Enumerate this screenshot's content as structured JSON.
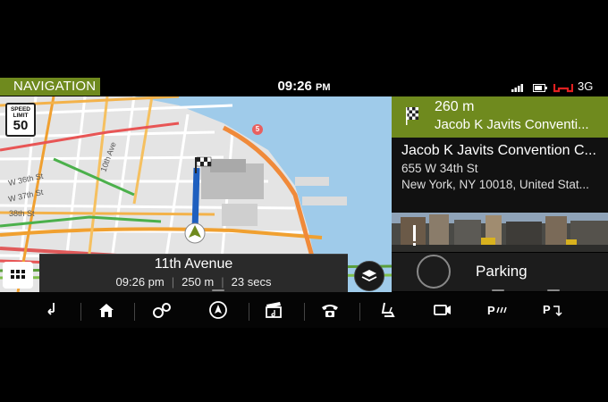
{
  "status": {
    "app_title": "NAVIGATION",
    "time": "09:26",
    "time_suffix": "PM",
    "network": "3G"
  },
  "map": {
    "speed_limit_label": "SPEED LIMIT",
    "speed_limit_value": "50",
    "route_marker_number": "5",
    "street_labels": [
      "W 36th St",
      "W 37th St",
      "38th St",
      "10th Ave"
    ]
  },
  "route": {
    "street": "11th Avenue",
    "eta": "09:26 pm",
    "distance": "250 m",
    "duration": "23 secs"
  },
  "next_turn": {
    "distance": "260 m",
    "destination": "Jacob K Javits Conventi..."
  },
  "destination": {
    "name": "Jacob K Javits Convention C...",
    "address_line1": "655 W 34th St",
    "address_line2": "New York, NY 10018, United Stat..."
  },
  "parking": {
    "label": "Parking"
  },
  "navbar": {
    "items": [
      "back-icon",
      "home-icon",
      "settings-icon",
      "navigation-icon",
      "media-icon",
      "phone-icon",
      "seat-icon",
      "camera-icon",
      "park-assist-icon",
      "park-exit-icon"
    ]
  },
  "colors": {
    "accent": "#6f8a1e",
    "route": "#1e5fbf",
    "water": "#9fcbea"
  }
}
